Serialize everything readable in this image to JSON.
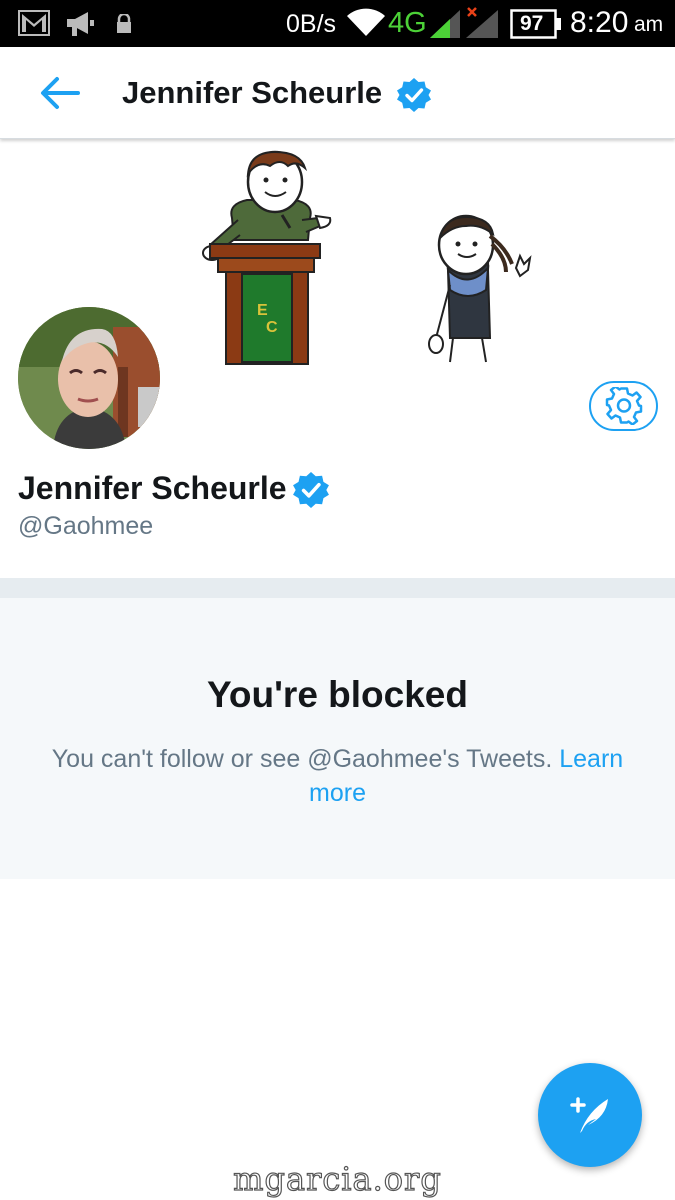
{
  "status_bar": {
    "net_speed": "0B/s",
    "network_type": "4G",
    "battery": "97",
    "time": "8:20",
    "ampm": "am",
    "icons": [
      "gmail-icon",
      "megaphone-icon",
      "lock-icon",
      "wifi-icon",
      "signal-icon",
      "signal-no-service-icon",
      "battery-icon"
    ]
  },
  "app_bar": {
    "title": "Jennifer Scheurle",
    "back_icon": "arrow-left-icon",
    "verified_icon": "verified-badge-icon"
  },
  "profile": {
    "name": "Jennifer Scheurle",
    "handle": "@Gaohmee",
    "settings_icon": "gear-icon",
    "banner_sign": "EC"
  },
  "blocked": {
    "title": "You're blocked",
    "message": "You can't follow or see @Gaohmee's Tweets.",
    "learn_more": "Learn more"
  },
  "fab": {
    "icon": "compose-tweet-icon"
  },
  "watermark": "mgarcia.org",
  "colors": {
    "accent": "#1da1f2",
    "text_primary": "#14171a",
    "text_secondary": "#657786",
    "panel_bg": "#f5f8fa",
    "divider": "#e6ecf0"
  }
}
